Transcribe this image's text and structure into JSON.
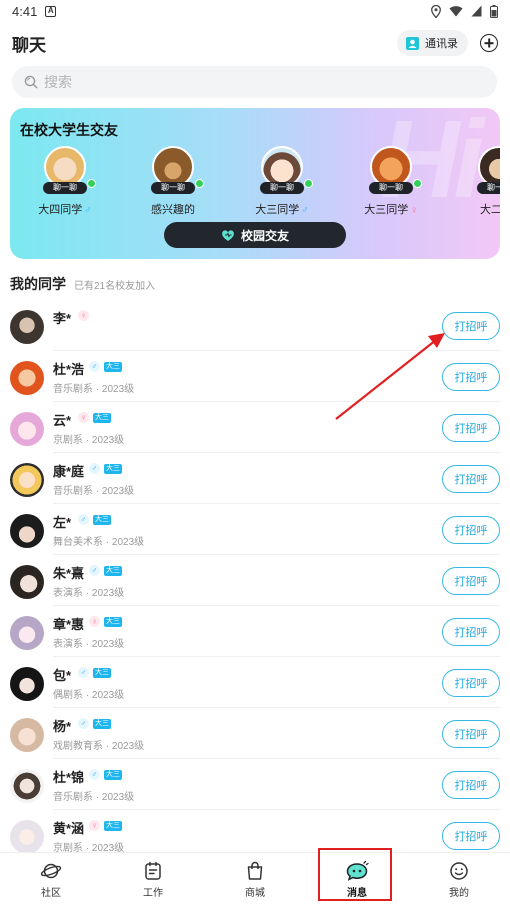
{
  "status_bar": {
    "time": "4:41",
    "a_label": "A"
  },
  "header": {
    "title": "聊天",
    "contacts_label": "通讯录"
  },
  "search": {
    "placeholder": "搜索"
  },
  "banner": {
    "title": "在校大学生交友",
    "watermark": "Hi",
    "chat_tag": "聊一聊",
    "peers": [
      {
        "desc": "大四同学",
        "gender": "male",
        "gender_icon": "♂"
      },
      {
        "desc": "感兴趣的",
        "gender": "",
        "gender_icon": ""
      },
      {
        "desc": "大三同学",
        "gender": "male",
        "gender_icon": "♂"
      },
      {
        "desc": "大三同学",
        "gender": "female",
        "gender_icon": "♀"
      },
      {
        "desc": "大二同",
        "gender": "",
        "gender_icon": ""
      }
    ],
    "campus_button": "校园交友"
  },
  "section": {
    "title": "我的同学",
    "subtitle": "已有21名校友加入"
  },
  "greet_label": "打招呼",
  "students": [
    {
      "name": "李*",
      "gender": "female",
      "gender_icon": "♀",
      "grade": "",
      "meta": ""
    },
    {
      "name": "杜*浩",
      "gender": "male",
      "gender_icon": "♂",
      "grade": "大三",
      "meta": "音乐剧系 · 2023级"
    },
    {
      "name": "云*",
      "gender": "female",
      "gender_icon": "♀",
      "grade": "大三",
      "meta": "京剧系 · 2023级"
    },
    {
      "name": "康*庭",
      "gender": "male",
      "gender_icon": "♂",
      "grade": "大三",
      "meta": "音乐剧系 · 2023级"
    },
    {
      "name": "左*",
      "gender": "male",
      "gender_icon": "♂",
      "grade": "大三",
      "meta": "舞台美术系 · 2023级"
    },
    {
      "name": "朱*熹",
      "gender": "male",
      "gender_icon": "♂",
      "grade": "大三",
      "meta": "表演系 · 2023级"
    },
    {
      "name": "章*惠",
      "gender": "female",
      "gender_icon": "♀",
      "grade": "大三",
      "meta": "表演系 · 2023级"
    },
    {
      "name": "包*",
      "gender": "male",
      "gender_icon": "♂",
      "grade": "大三",
      "meta": "偶剧系 · 2023级"
    },
    {
      "name": "杨*",
      "gender": "male",
      "gender_icon": "♂",
      "grade": "大三",
      "meta": "戏剧教育系 · 2023级"
    },
    {
      "name": "杜*锦",
      "gender": "male",
      "gender_icon": "♂",
      "grade": "大三",
      "meta": "音乐剧系 · 2023级"
    },
    {
      "name": "黄*涵",
      "gender": "female",
      "gender_icon": "♀",
      "grade": "大三",
      "meta": "京剧系 · 2023级"
    }
  ],
  "tabbar": {
    "items": [
      {
        "label": "社区",
        "icon": "planet-icon"
      },
      {
        "label": "工作",
        "icon": "clipboard-icon"
      },
      {
        "label": "商城",
        "icon": "shopping-bag-icon"
      },
      {
        "label": "消息",
        "icon": "chat-bubble-icon"
      },
      {
        "label": "我的",
        "icon": "smiley-icon"
      }
    ],
    "active": "消息"
  },
  "colors": {
    "accent": "#1ea9e0",
    "annotation_red": "#e02020",
    "online_green": "#33d15a",
    "female_pink": "#ff6a8c",
    "male_blue": "#32b3f2",
    "grade_blue": "#1fb6ee"
  }
}
